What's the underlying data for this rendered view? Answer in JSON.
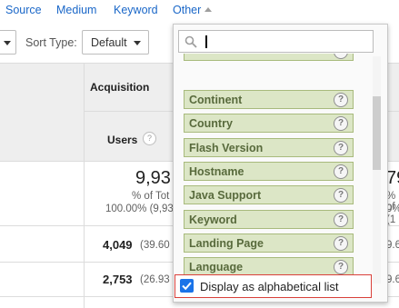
{
  "top_links": {
    "source": "Source",
    "medium": "Medium",
    "keyword": "Keyword",
    "other": "Other"
  },
  "toolbar": {
    "sort_type_label": "Sort Type:",
    "sort_type_value": "Default"
  },
  "table": {
    "group_header": "Acquisition",
    "column_header": "Users",
    "totals": {
      "value_partial": "9,93",
      "pct_label_partial": "% of Tot",
      "pct_value_partial": "100.00% (9,93",
      "right_value_partial": "79",
      "right_pct_partial": "% of",
      "right_pct2_partial": "0% (1"
    },
    "rows": [
      {
        "value": "4,049",
        "pct_partial": "(39.60",
        "right_partial": "9.6"
      },
      {
        "value": "2,753",
        "pct_partial": "(26.93",
        "right_partial": "9.6"
      }
    ]
  },
  "dropdown": {
    "search_value": "",
    "items": [
      {
        "label": "",
        "icon": "help-icon"
      },
      {
        "label": "Continent",
        "icon": "help-icon"
      },
      {
        "label": "Country",
        "icon": "help-icon"
      },
      {
        "label": "Flash Version",
        "icon": "help-icon"
      },
      {
        "label": "Hostname",
        "icon": "help-icon"
      },
      {
        "label": "Java Support",
        "icon": "help-icon"
      },
      {
        "label": "Keyword",
        "icon": "help-icon"
      },
      {
        "label": "Landing Page",
        "icon": "help-icon"
      },
      {
        "label": "Language",
        "icon": "help-icon"
      },
      {
        "label": "",
        "icon": "help-icon"
      }
    ],
    "footer_checkbox_checked": true,
    "footer_label": "Display as alphabetical list"
  },
  "colors": {
    "link": "#1a67c8",
    "item_bg": "#dce6c6",
    "item_border": "#a8ba7c",
    "item_text": "#586a3c",
    "highlight_border": "#d9403a",
    "checkbox": "#1a73e8"
  }
}
